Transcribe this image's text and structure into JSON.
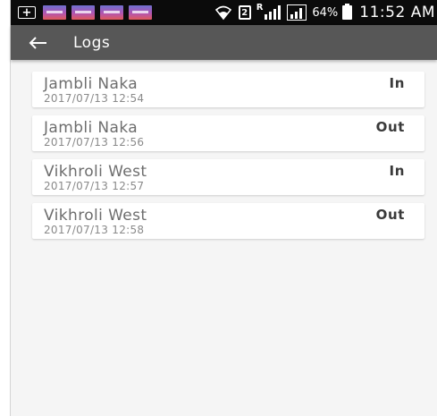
{
  "status_bar": {
    "sim_label": "2",
    "roaming_label": "R",
    "battery_percent": "64%",
    "time": "11:52 AM",
    "notification_icons": [
      "plus-icon",
      "app-notification-icon",
      "app-notification-icon",
      "app-notification-icon",
      "app-notification-icon"
    ]
  },
  "toolbar": {
    "title": "Logs",
    "back_icon": "arrow-left-icon"
  },
  "logs": [
    {
      "location": "Jambli Naka",
      "timestamp": "2017/07/13 12:54",
      "status": "In"
    },
    {
      "location": "Jambli Naka",
      "timestamp": "2017/07/13 12:56",
      "status": "Out"
    },
    {
      "location": "Vikhroli West",
      "timestamp": "2017/07/13 12:57",
      "status": "In"
    },
    {
      "location": "Vikhroli West",
      "timestamp": "2017/07/13 12:58",
      "status": "Out"
    }
  ],
  "colors": {
    "toolbar_background": "#575757",
    "status_bar_background": "#0b0b0b",
    "page_background": "#f5f5f5",
    "card_background": "#ffffff"
  }
}
